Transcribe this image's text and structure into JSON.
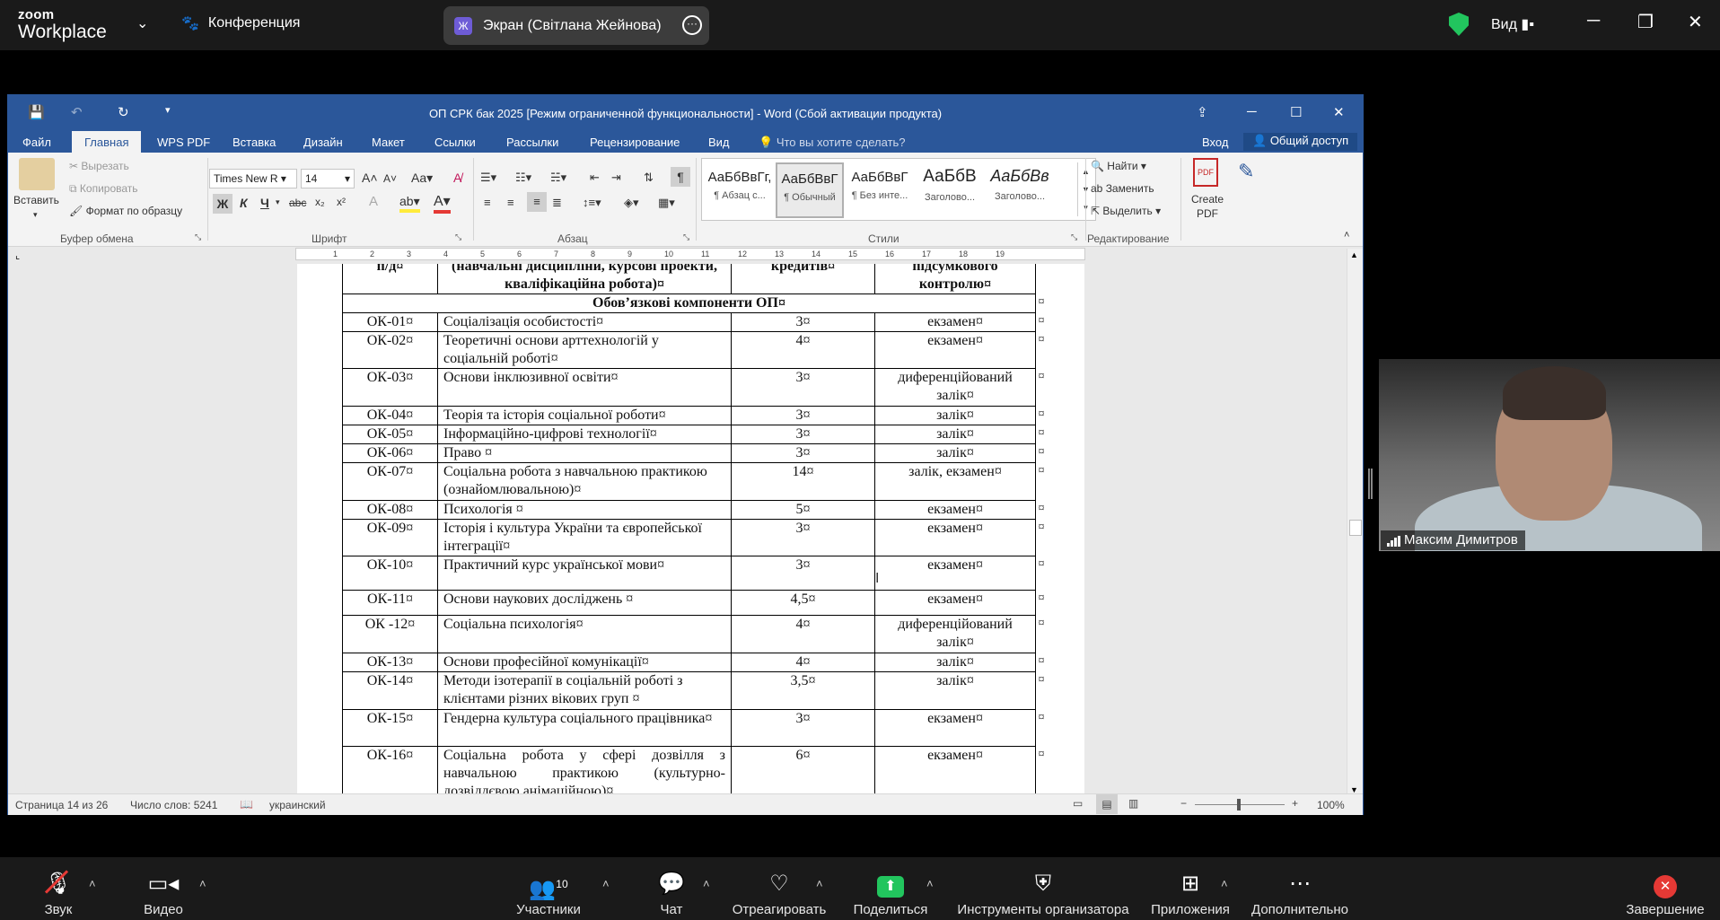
{
  "zoom": {
    "brand_top": "zoom",
    "brand_bottom": "Workplace",
    "meeting_label": "Конференция",
    "screen_share_label": "Экран (Світлана Жейнова)",
    "screen_share_avatar": "Ж",
    "view_label": "Вид",
    "participant_name": "Максим Димитров",
    "participants_count": "10",
    "toolbar": {
      "audio": "Звук",
      "video": "Видео",
      "participants": "Участники",
      "chat": "Чат",
      "react": "Отреагировать",
      "share": "Поделиться",
      "host_tools": "Инструменты организатора",
      "apps": "Приложения",
      "more": "Дополнительно",
      "end": "Завершение"
    },
    "colors": {
      "share_green": "#22c55e",
      "end_red": "#e53935"
    }
  },
  "word": {
    "title": "ОП СРК бак 2025 [Режим ограниченной функциональности] - Word (Сбой активации продукта)",
    "tabs": [
      "Файл",
      "Главная",
      "WPS PDF",
      "Вставка",
      "Дизайн",
      "Макет",
      "Ссылки",
      "Рассылки",
      "Рецензирование",
      "Вид"
    ],
    "tell_me": "Что вы хотите сделать?",
    "sign_in": "Вход",
    "share": "Общий доступ",
    "clipboard": {
      "paste": "Вставить",
      "cut": "Вырезать",
      "copy": "Копировать",
      "format_painter": "Формат по образцу",
      "group": "Буфер обмена"
    },
    "font": {
      "name": "Times New R",
      "size": "14",
      "group": "Шрифт"
    },
    "paragraph_group": "Абзац",
    "styles": {
      "group": "Стили",
      "items": [
        {
          "preview": "АаБбВвГг,",
          "name": "¶ Абзац с..."
        },
        {
          "preview": "АаБбВвГ",
          "name": "¶ Обычный"
        },
        {
          "preview": "АаБбВвГ",
          "name": "¶ Без инте..."
        },
        {
          "preview": "АаБбВ",
          "name": "Заголово..."
        },
        {
          "preview": "АаБбВв",
          "name": "Заголово..."
        }
      ]
    },
    "editing": {
      "find": "Найти",
      "replace": "Заменить",
      "select": "Выделить",
      "group": "Редактирование"
    },
    "create_pdf": "Create PDF",
    "status": {
      "page": "Страница 14 из 26",
      "words": "Число слов: 5241",
      "language": "украинский",
      "zoom": "100%"
    },
    "table": {
      "header_partial": [
        "п/д¤",
        "(навчальні дисципліни, курсові проекти, кваліфікаційна робота)¤",
        "кредитів¤",
        "підсумкового контролю¤"
      ],
      "section_title": "Обов’язкові компоненти ОП¤",
      "rows": [
        [
          "ОК-01¤",
          "Соціалізація особистості¤",
          "3¤",
          "екзамен¤"
        ],
        [
          "ОК-02¤",
          "Теоретичні основи арттехнологій у соціальній роботі¤",
          "4¤",
          "екзамен¤"
        ],
        [
          "ОК-03¤",
          "Основи інклюзивної освіти¤",
          "3¤",
          "диференційований залік¤"
        ],
        [
          "ОК-04¤",
          "Теорія та історія соціальної роботи¤",
          "3¤",
          "залік¤"
        ],
        [
          "ОК-05¤",
          "Інформаційно-цифрові технології¤",
          "3¤",
          "залік¤"
        ],
        [
          "ОК-06¤",
          "Право ¤",
          "3¤",
          "залік¤"
        ],
        [
          "ОК-07¤",
          "Соціальна робота з навчальною практикою (ознайомлювальною)¤",
          "14¤",
          "залік, екзамен¤"
        ],
        [
          "ОК-08¤",
          "Психологія ¤",
          "5¤",
          "екзамен¤"
        ],
        [
          "ОК-09¤",
          "Історія і культура України та європейської інтеграції¤",
          "3¤",
          "екзамен¤"
        ],
        [
          "ОК-10¤",
          "Практичний курс української мови¤",
          "3¤",
          "екзамен¤"
        ],
        [
          "ОК-11¤",
          "Основи наукових досліджень ¤",
          "4,5¤",
          "екзамен¤"
        ],
        [
          "ОК -12¤",
          "Соціальна психологія¤",
          "4¤",
          "диференційований залік¤"
        ],
        [
          "ОК-13¤",
          "Основи професійної комунікації¤",
          "4¤",
          "залік¤"
        ],
        [
          "ОК-14¤",
          "Методи ізотерапії в соціальній роботі з клієнтами різних вікових груп ¤",
          "3,5¤",
          "залік¤"
        ],
        [
          "ОК-15¤",
          "Гендерна культура соціального працівника¤",
          "3¤",
          "екзамен¤"
        ],
        [
          "ОК-16¤",
          "Соціальна робота у сфері дозвілля з навчальною практикою (культурно-дозвіллєвою анімаційною)¤",
          "6¤",
          "екзамен¤"
        ]
      ]
    }
  }
}
